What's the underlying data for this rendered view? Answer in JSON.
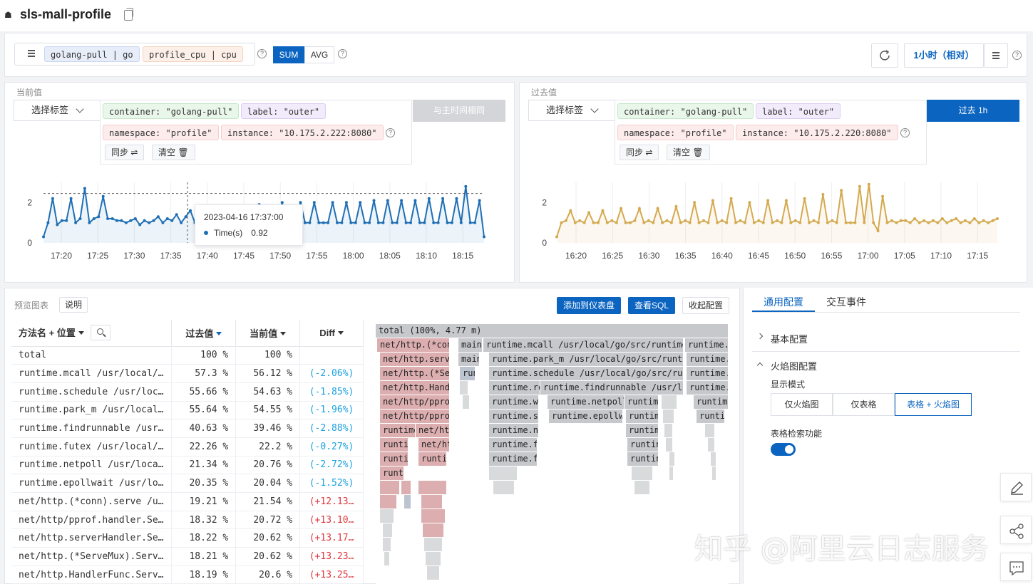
{
  "app": {
    "title": "sls-mall-profile"
  },
  "query": {
    "chips": [
      "golang-pull | go",
      "profile_cpu | cpu"
    ],
    "agg_sum": "SUM",
    "agg_avg": "AVG",
    "help": "?",
    "time_range": "1小时（相对）"
  },
  "current": {
    "label": "当前值",
    "select_tags": "选择标签",
    "tags": [
      "container: \"golang-pull\"",
      "label: \"outer\"",
      "namespace: \"profile\"",
      "instance: \"10.175.2.222:8080\""
    ],
    "sync": "同步 ⇌",
    "clear": "清空 🗑",
    "compare_button": "与主时间相同",
    "chart_data": {
      "type": "line",
      "x_ticks": [
        "17:20",
        "17:25",
        "17:30",
        "17:35",
        "17:40",
        "17:45",
        "17:50",
        "17:55",
        "18:00",
        "18:05",
        "18:10",
        "18:15"
      ],
      "y_ticks": [
        "0",
        "2"
      ],
      "ylim": [
        0,
        3
      ],
      "color": "#1f6fb5",
      "avg_line": 2.45,
      "values": [
        0.3,
        1.0,
        2.2,
        0.9,
        1.1,
        1.1,
        2.2,
        1.0,
        1.2,
        2.7,
        1.0,
        1.2,
        1.3,
        2.3,
        1.2,
        1.2,
        1.1,
        1.1,
        1.0,
        1.1,
        1.2,
        0.9,
        1.1,
        1.0,
        1.1,
        1.3,
        1.0,
        1.2,
        1.1,
        1.4,
        1.0,
        1.3,
        1.6,
        1.0,
        1.2,
        1.1,
        1.0,
        1.0,
        0.92,
        1.0,
        1.0,
        1.1,
        1.1,
        1.0,
        1.0,
        1.1,
        1.0,
        1.9,
        1.0,
        1.0,
        1.1,
        1.0,
        2.0,
        1.0,
        1.1,
        1.1,
        2.0,
        1.0,
        1.0,
        2.0,
        1.0,
        1.0,
        1.0,
        2.0,
        1.0,
        1.0,
        2.0,
        1.0,
        1.0,
        2.0,
        1.0,
        1.0,
        2.1,
        1.0,
        1.0,
        2.1,
        1.0,
        1.0,
        2.1,
        1.0,
        1.0,
        2.1,
        1.0,
        1.0,
        2.2,
        1.0,
        1.0,
        2.2,
        1.0,
        1.0,
        2.2,
        1.0,
        2.8,
        1.0,
        1.0,
        2.1,
        0.3
      ],
      "tooltip": {
        "time": "2023-04-16 17:37:00",
        "series": "Time(s)",
        "value": "0.92"
      }
    }
  },
  "past": {
    "label": "过去值",
    "select_tags": "选择标签",
    "tags": [
      "container: \"golang-pull\"",
      "label: \"outer\"",
      "namespace: \"profile\"",
      "instance: \"10.175.2.220:8080\""
    ],
    "sync": "同步 ⇌",
    "clear": "清空 🗑",
    "compare_button": "过去 1h",
    "chart_data": {
      "type": "line",
      "x_ticks": [
        "16:20",
        "16:25",
        "16:30",
        "16:35",
        "16:40",
        "16:45",
        "16:50",
        "16:55",
        "17:00",
        "17:05",
        "17:10",
        "17:15"
      ],
      "y_ticks": [
        "0",
        "2"
      ],
      "ylim": [
        0,
        3
      ],
      "color": "#d4aa50",
      "values": [
        0.3,
        1.0,
        1.1,
        1.6,
        1.0,
        1.1,
        1.0,
        1.5,
        1.0,
        1.0,
        1.6,
        1.0,
        1.1,
        1.0,
        1.7,
        1.0,
        1.0,
        1.1,
        1.7,
        1.0,
        1.1,
        1.0,
        1.7,
        1.0,
        1.1,
        1.0,
        1.8,
        1.0,
        1.1,
        1.0,
        2.0,
        1.0,
        1.1,
        1.0,
        2.1,
        1.0,
        1.1,
        1.0,
        2.2,
        1.0,
        1.1,
        1.0,
        2.0,
        1.0,
        1.1,
        1.0,
        2.1,
        1.0,
        1.1,
        1.0,
        2.1,
        1.0,
        1.1,
        1.0,
        2.2,
        1.0,
        1.1,
        1.0,
        2.4,
        1.0,
        1.1,
        1.0,
        2.6,
        1.0,
        1.0,
        1.0,
        2.8,
        1.0,
        2.9,
        1.0,
        0.6,
        2.3,
        1.0,
        1.1,
        1.0,
        1.1,
        1.1,
        1.0,
        1.2,
        1.0,
        1.1,
        1.0,
        1.1,
        1.0,
        1.2,
        1.0,
        1.1,
        1.2,
        1.0,
        1.1,
        1.0,
        1.2,
        1.0,
        1.1,
        1.0,
        1.1,
        1.2
      ]
    }
  },
  "preview": {
    "title": "预览图表",
    "explain": "说明",
    "add_dashboard": "添加到仪表盘",
    "view_sql": "查看SQL",
    "collapse": "收起配置",
    "columns": [
      "方法名 + 位置",
      "过去值",
      "当前值",
      "Diff"
    ],
    "rows": [
      {
        "name": "total",
        "past": "100 %",
        "cur": "100 %",
        "diff": ""
      },
      {
        "name": "runtime.mcall /usr/local/…",
        "past": "57.3 %",
        "cur": "56.12 %",
        "diff": "(-2.06%)"
      },
      {
        "name": "runtime.schedule /usr/loc…",
        "past": "55.66 %",
        "cur": "54.63 %",
        "diff": "(-1.85%)"
      },
      {
        "name": "runtime.park_m /usr/local…",
        "past": "55.64 %",
        "cur": "54.55 %",
        "diff": "(-1.96%)"
      },
      {
        "name": "runtime.findrunnable /usr…",
        "past": "40.63 %",
        "cur": "39.46 %",
        "diff": "(-2.88%)"
      },
      {
        "name": "runtime.futex /usr/local/…",
        "past": "22.26 %",
        "cur": "22.2 %",
        "diff": "(-0.27%)"
      },
      {
        "name": "runtime.netpoll /usr/loca…",
        "past": "21.34 %",
        "cur": "20.76 %",
        "diff": "(-2.72%)"
      },
      {
        "name": "runtime.epollwait /usr/lo…",
        "past": "20.35 %",
        "cur": "20.04 %",
        "diff": "(-1.52%)"
      },
      {
        "name": "net/http.(*conn).serve /u…",
        "past": "19.21 %",
        "cur": "21.54 %",
        "diff": "(+12.13…"
      },
      {
        "name": "net/http/pprof.handler.Se…",
        "past": "18.32 %",
        "cur": "20.72 %",
        "diff": "(+13.10…"
      },
      {
        "name": "net/http.serverHandler.Se…",
        "past": "18.22 %",
        "cur": "20.62 %",
        "diff": "(+13.17…"
      },
      {
        "name": "net/http.(*ServeMux).Serv…",
        "past": "18.21 %",
        "cur": "20.62 %",
        "diff": "(+13.23…"
      },
      {
        "name": "net/http.HandlerFunc.Serv…",
        "past": "18.19 %",
        "cur": "20.6 %",
        "diff": "(+13.25…"
      }
    ],
    "flame_root": "total (100%, 4.77 m)",
    "flame_labels": {
      "conn": "net/http.(*con",
      "serve": "net/http.serve",
      "servemux": "net/http.(*Ser",
      "handler": "net/http.Handl",
      "pprof1": "net/http/pprof",
      "pprof2": "net/http/pprof",
      "runtime1": "runtime",
      "nethttp": "net/ht",
      "runti1": "runti",
      "runti2": "runti",
      "nethttp2": "net/ht",
      "runti3": "runti",
      "runt": "runt",
      "main1": "main.",
      "main2": "main",
      "run1": "run",
      "mcall": "runtime.mcall /usr/local/go/src/runtime/…",
      "park": "runtime.park_m /usr/local/go/src/runtim",
      "schedule": "runtime.schedule /usr/local/go/src/run",
      "re": "runtime.re",
      "findrunnable": "runtime.findrunnable /usr/lo",
      "wa": "runtime.wa",
      "netpoll": "runtime.netpoll",
      "st": "runtime.st",
      "epollw": "runtime.epollw",
      "no": "runtime.no",
      "fu1": "runtime.fu",
      "fu2": "runtime.fu",
      "r1": "runtime.",
      "r2": "runtime.",
      "r3": "runtime.",
      "r4": "runtime.",
      "r5": "runtime",
      "r6": "runtim",
      "r7": "runtim",
      "r8": "runtin",
      "r9": "runtin",
      "r10": "runtime",
      "r11": "runtir",
      "r12": "runti"
    }
  },
  "config": {
    "tab_general": "通用配置",
    "tab_events": "交互事件",
    "basic": "基本配置",
    "flame": "火焰图配置",
    "display_mode": "显示模式",
    "modes": [
      "仅火焰图",
      "仅表格",
      "表格 + 火焰图"
    ],
    "table_search": "表格检索功能"
  },
  "watermark": "知乎 @阿里云日志服务"
}
